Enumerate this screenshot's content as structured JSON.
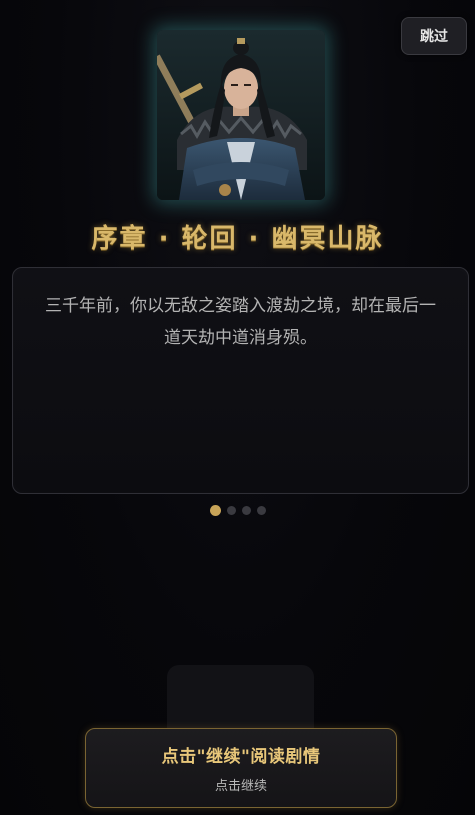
{
  "header": {
    "skip_label": "跳过"
  },
  "portrait": {
    "icon": "swordsman-portrait"
  },
  "chapter": {
    "title": "序章 · 轮回 · 幽冥山脉"
  },
  "story": {
    "text": "三千年前，你以无敌之姿踏入渡劫之境，却在最后一道天劫中道消身殒。"
  },
  "pagination": {
    "total_pages": 4,
    "current_page": 1
  },
  "footer": {
    "continue_main": "点击\"继续\"阅读剧情",
    "continue_sub": "点击继续"
  },
  "colors": {
    "accent_gold": "#d9b86a",
    "portrait_glow": "#3c9696",
    "background": "#07070b"
  }
}
